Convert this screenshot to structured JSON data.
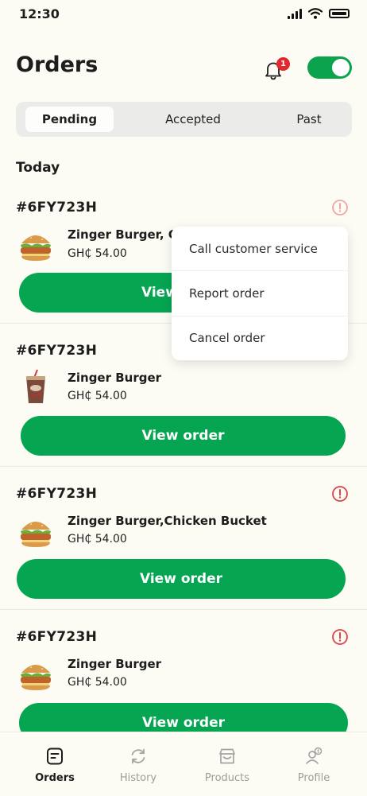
{
  "status_bar": {
    "time": "12:30"
  },
  "header": {
    "title": "Orders",
    "notification_count": "1",
    "online_toggle": true
  },
  "tabs": [
    {
      "label": "Pending",
      "active": true
    },
    {
      "label": "Accepted",
      "active": false
    },
    {
      "label": "Past",
      "active": false
    }
  ],
  "section_title": "Today",
  "orders": [
    {
      "id": "#6FY723H",
      "item": "Zinger Burger, Chicken Bucket",
      "price": "GH₵ 54.00",
      "button": "View order",
      "image": "burger-icon"
    },
    {
      "id": "#6FY723H",
      "item": "Zinger Burger",
      "price": "GH₵ 54.00",
      "button": "View order",
      "image": "drink-icon"
    },
    {
      "id": "#6FY723H",
      "item": "Zinger Burger,Chicken Bucket",
      "price": "GH₵ 54.00",
      "button": "View order",
      "image": "burger-icon"
    },
    {
      "id": "#6FY723H",
      "item": "Zinger Burger",
      "price": "GH₵ 54.00",
      "button": "View order",
      "image": "burger-icon"
    }
  ],
  "context_menu": {
    "items": [
      "Call customer service",
      "Report order",
      "Cancel order"
    ]
  },
  "bottom_nav": [
    {
      "label": "Orders",
      "icon": "orders-icon",
      "active": true
    },
    {
      "label": "History",
      "icon": "history-icon",
      "active": false
    },
    {
      "label": "Products",
      "icon": "store-icon",
      "active": false
    },
    {
      "label": "Profile",
      "icon": "profile-icon",
      "active": false
    }
  ],
  "colors": {
    "accent": "#05a552",
    "badge": "#e0282e",
    "alert": "#e0424a",
    "background": "#fcfbf4"
  }
}
